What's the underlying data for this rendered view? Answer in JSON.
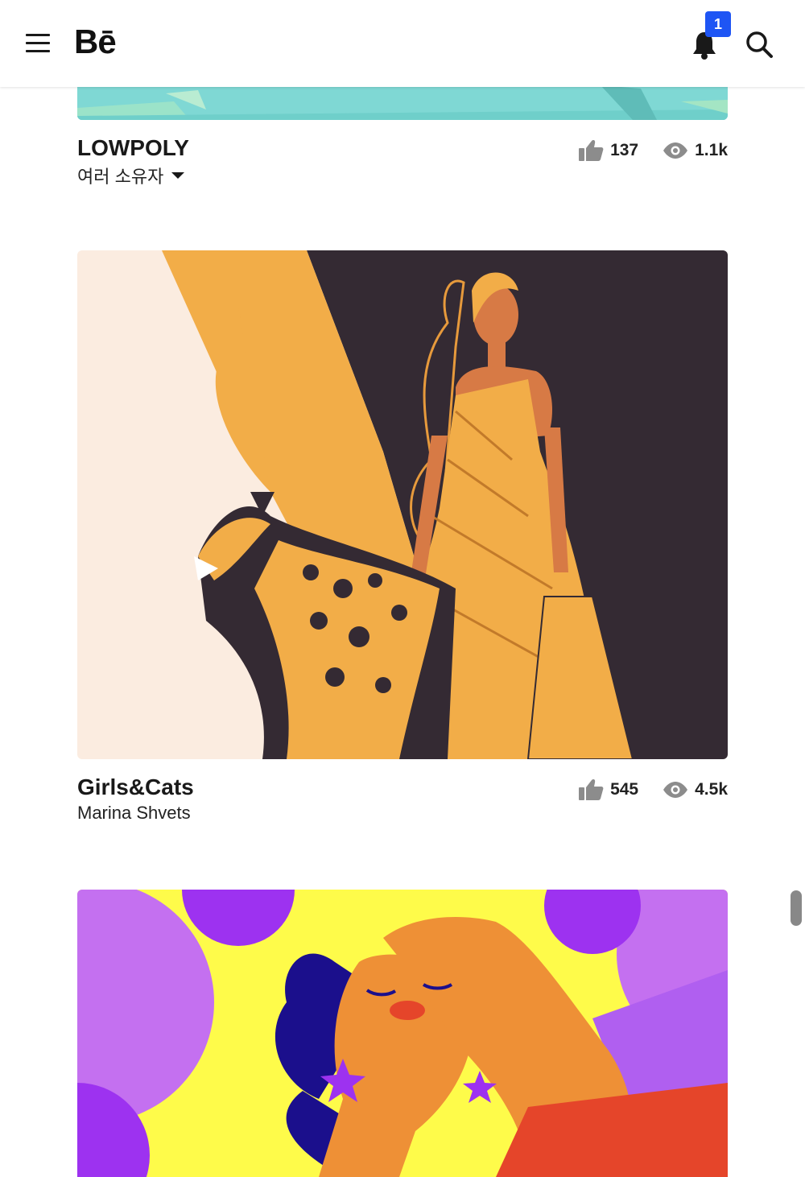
{
  "header": {
    "logo": "Bē",
    "notification_count": "1",
    "icons": [
      "menu-icon",
      "bell-icon",
      "search-icon"
    ]
  },
  "projects": [
    {
      "title": "LOWPOLY",
      "owner": "여러 소유자",
      "owner_has_dropdown": true,
      "appreciations": "137",
      "views": "1.1k"
    },
    {
      "title": "Girls&Cats",
      "owner": "Marina Shvets",
      "owner_has_dropdown": false,
      "appreciations": "545",
      "views": "4.5k"
    }
  ],
  "colors": {
    "brand_blue": "#1e55f4",
    "text": "#191919",
    "stat_icon": "#8c8c8c"
  }
}
